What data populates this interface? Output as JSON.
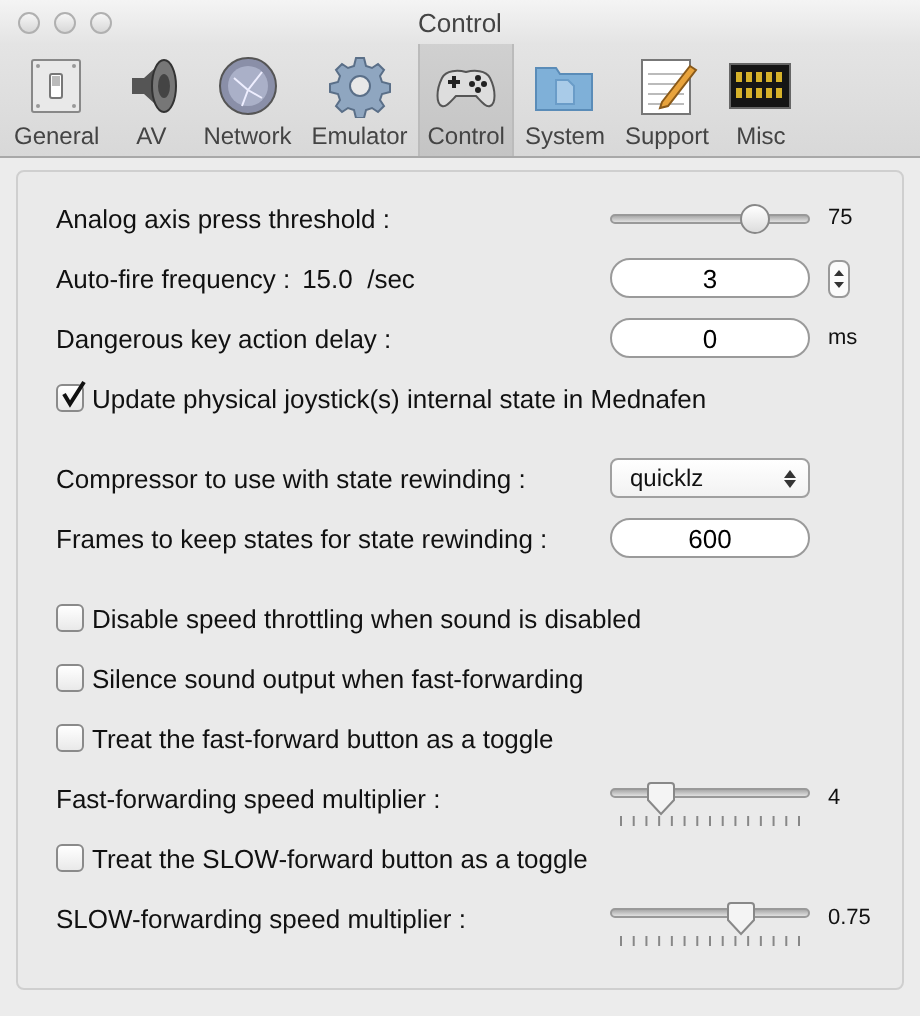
{
  "window": {
    "title": "Control"
  },
  "toolbar": [
    {
      "label": "General",
      "kind": "switch",
      "selected": false
    },
    {
      "label": "AV",
      "kind": "speaker",
      "selected": false
    },
    {
      "label": "Network",
      "kind": "globe",
      "selected": false
    },
    {
      "label": "Emulator",
      "kind": "gear",
      "selected": false
    },
    {
      "label": "Control",
      "kind": "gamepad",
      "selected": true
    },
    {
      "label": "System",
      "kind": "folder",
      "selected": false
    },
    {
      "label": "Support",
      "kind": "notepad",
      "selected": false
    },
    {
      "label": "Misc",
      "kind": "display",
      "selected": false
    }
  ],
  "sections": [
    [
      {
        "kind": "slider",
        "label": "Analog axis press threshold :",
        "level": 0.72,
        "reading": "75"
      },
      {
        "kind": "stepper",
        "label": "Auto-fire frequency :",
        "reading": "15.0  /sec",
        "value": "3"
      },
      {
        "kind": "field",
        "label": "Dangerous key action delay :",
        "value": "0",
        "unit": "ms"
      },
      {
        "kind": "checkbox",
        "label": "Update physical joystick(s) internal state in Mednafen",
        "checked": true
      }
    ],
    [
      {
        "kind": "select",
        "label": "Compressor to use with state rewinding :",
        "value": "quicklz"
      },
      {
        "kind": "field",
        "label": "Frames to keep states for state rewinding :",
        "value": "600"
      }
    ],
    [
      {
        "kind": "checkbox",
        "label": "Disable speed throttling when sound is disabled",
        "checked": false
      },
      {
        "kind": "checkbox",
        "label": "Silence sound output when fast-forwarding",
        "checked": false
      },
      {
        "kind": "checkbox",
        "label": "Treat the fast-forward button as a toggle",
        "checked": false
      },
      {
        "kind": "ticked-slider",
        "label": "Fast-forwarding speed multiplier :",
        "level": 0.25,
        "reading": "4"
      },
      {
        "kind": "checkbox",
        "label": "Treat the SLOW-forward button as a toggle",
        "checked": false
      },
      {
        "kind": "ticked-slider",
        "label": "SLOW-forwarding speed multiplier :",
        "level": 0.65,
        "reading": "0.75"
      }
    ]
  ]
}
